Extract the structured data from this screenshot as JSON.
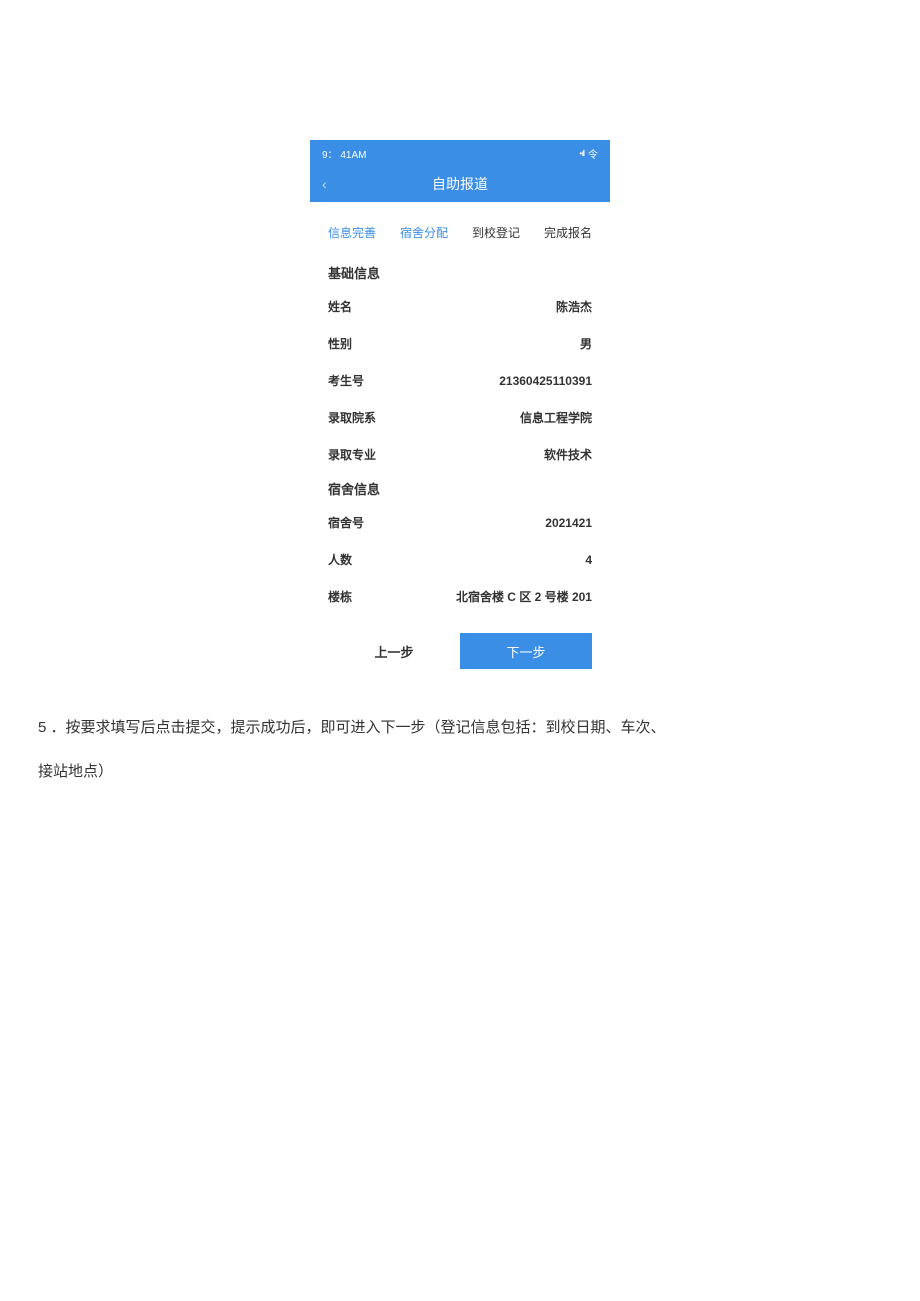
{
  "status_bar": {
    "time": "9： 41AM",
    "signal": "•ıll",
    "extra": "令"
  },
  "nav": {
    "title": "自助报道"
  },
  "tabs": [
    {
      "label": "信息完善",
      "active": true
    },
    {
      "label": "宿舍分配",
      "active": true
    },
    {
      "label": "到校登记",
      "active": false
    },
    {
      "label": "完成报名",
      "active": false
    }
  ],
  "sections": {
    "basic": {
      "title": "基础信息",
      "rows": [
        {
          "label": "姓名",
          "value": "陈浩杰"
        },
        {
          "label": "性别",
          "value": "男"
        },
        {
          "label": "考生号",
          "value": "21360425110391"
        },
        {
          "label": "录取院系",
          "value": "信息工程学院"
        },
        {
          "label": "录取专业",
          "value": "软件技术"
        }
      ]
    },
    "dorm": {
      "title": "宿舍信息",
      "rows": [
        {
          "label": "宿舍号",
          "value": "2021421"
        },
        {
          "label": "人数",
          "value": "4"
        },
        {
          "label": "楼栋",
          "value": "北宿舍楼 C 区 2 号楼 201"
        }
      ]
    }
  },
  "buttons": {
    "prev": "上一步",
    "next": "下一步"
  },
  "instruction": {
    "line1": "5 ．按要求填写后点击提交，提示成功后，即可进入下一步（登记信息包括：到校日期、车次、",
    "line2": "接站地点）"
  }
}
